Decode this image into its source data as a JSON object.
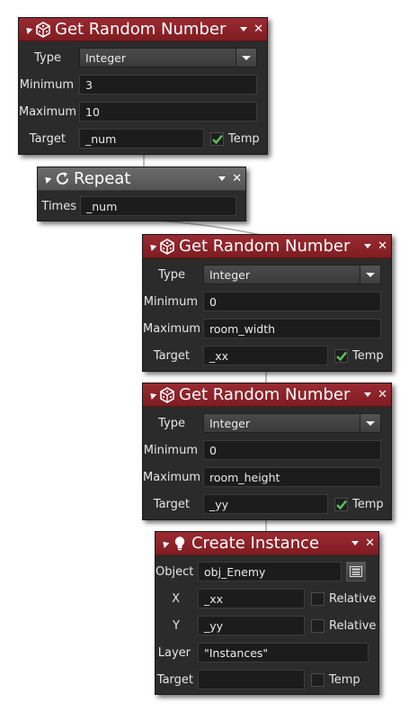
{
  "blocks": {
    "random1": {
      "title": "Get Random Number",
      "type_label": "Type",
      "type_value": "Integer",
      "min_label": "Minimum",
      "min_value": "3",
      "max_label": "Maximum",
      "max_value": "10",
      "target_label": "Target",
      "target_value": "_num",
      "temp_label": "Temp",
      "temp_checked": true
    },
    "repeat": {
      "title": "Repeat",
      "times_label": "Times",
      "times_value": "_num"
    },
    "random2": {
      "title": "Get Random Number",
      "type_label": "Type",
      "type_value": "Integer",
      "min_label": "Minimum",
      "min_value": "0",
      "max_label": "Maximum",
      "max_value": "room_width",
      "target_label": "Target",
      "target_value": "_xx",
      "temp_label": "Temp",
      "temp_checked": true
    },
    "random3": {
      "title": "Get Random Number",
      "type_label": "Type",
      "type_value": "Integer",
      "min_label": "Minimum",
      "min_value": "0",
      "max_label": "Maximum",
      "max_value": "room_height",
      "target_label": "Target",
      "target_value": "_yy",
      "temp_label": "Temp",
      "temp_checked": true
    },
    "create": {
      "title": "Create Instance",
      "object_label": "Object",
      "object_value": "obj_Enemy",
      "x_label": "X",
      "x_value": "_xx",
      "x_relative_label": "Relative",
      "x_relative_checked": false,
      "y_label": "Y",
      "y_value": "_yy",
      "y_relative_label": "Relative",
      "y_relative_checked": false,
      "layer_label": "Layer",
      "layer_value": "\"Instances\"",
      "target_label": "Target",
      "target_value": "",
      "temp_label": "Temp",
      "temp_checked": false
    }
  },
  "icons": {
    "random": "dice-icon",
    "repeat": "repeat-icon",
    "create": "lightbulb-icon",
    "collapse": "collapse-triangle-icon",
    "menu": "dropdown-menu-icon",
    "close": "close-icon",
    "check": "checkmark-icon",
    "object_picker": "object-picker-icon"
  },
  "colors": {
    "header_action": "#8c2329",
    "header_repeat": "#5f5f5f",
    "block_body": "#2b2b2b",
    "field_bg": "#1c1c1c",
    "check": "#5cc05c"
  }
}
